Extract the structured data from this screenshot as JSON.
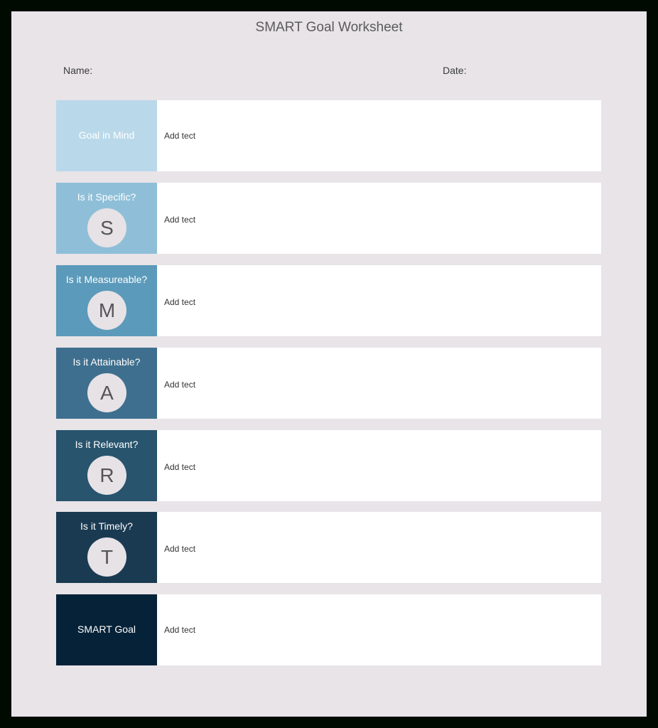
{
  "title": "SMART Goal Worksheet",
  "name_label": "Name:",
  "date_label": "Date:",
  "rows": [
    {
      "label": "Goal in Mind",
      "letter": null,
      "entry": "Add tect",
      "color": "#b9d9ea"
    },
    {
      "label": "Is it Specific?",
      "letter": "S",
      "entry": "Add tect",
      "color": "#8fbfd8"
    },
    {
      "label": "Is it Measureable?",
      "letter": "M",
      "entry": "Add tect",
      "color": "#5b9aba"
    },
    {
      "label": "Is it Attainable?",
      "letter": "A",
      "entry": "Add tect",
      "color": "#3f6f8e"
    },
    {
      "label": "Is it Relevant?",
      "letter": "R",
      "entry": "Add tect",
      "color": "#28546d"
    },
    {
      "label": "Is it Timely?",
      "letter": "T",
      "entry": "Add tect",
      "color": "#1a3a51"
    },
    {
      "label": "SMART Goal",
      "letter": null,
      "entry": "Add tect",
      "color": "#062238"
    }
  ]
}
